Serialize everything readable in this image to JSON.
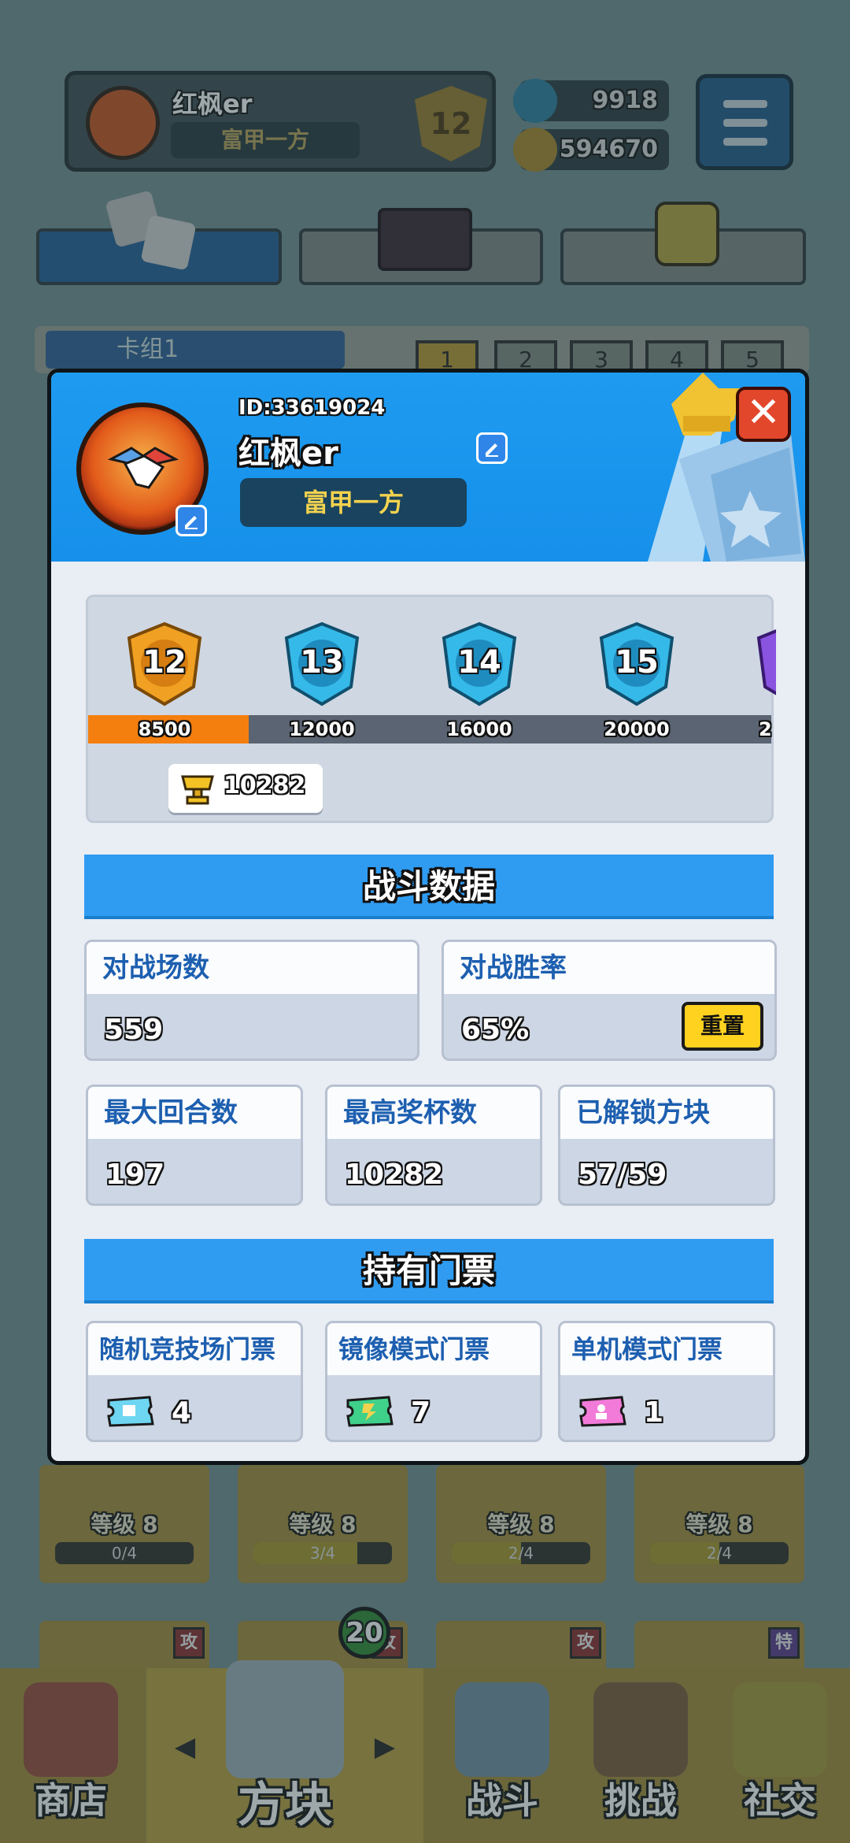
{
  "background": {
    "player": {
      "name": "红枫er",
      "title": "富甲一方",
      "rank": "12"
    },
    "currency": {
      "gems": "9918",
      "coins": "594670"
    },
    "deck_label": "卡组1",
    "deck_tabs": [
      "1",
      "2",
      "3",
      "4",
      "5"
    ],
    "cards": [
      {
        "level": "等级 8",
        "progress": "0/4",
        "fill": 0
      },
      {
        "level": "等级 8",
        "progress": "3/4",
        "fill": 0.75
      },
      {
        "level": "等级 8",
        "progress": "2/4",
        "fill": 0.5
      },
      {
        "level": "等级 8",
        "progress": "2/4",
        "fill": 0.5
      }
    ],
    "card_tags": [
      "攻",
      "攻",
      "攻",
      "特"
    ],
    "block_badge": "20"
  },
  "bottom_nav": [
    {
      "label": "商店",
      "active": false
    },
    {
      "label": "方块",
      "active": true
    },
    {
      "label": "战斗",
      "active": false
    },
    {
      "label": "挑战",
      "active": false
    },
    {
      "label": "社交",
      "active": false
    }
  ],
  "modal": {
    "id_text": "ID:33619024",
    "name": "红枫er",
    "title": "富甲一方",
    "close_label": "✕",
    "ranks": [
      {
        "level": "12",
        "threshold": "8500",
        "color": "#f0a022"
      },
      {
        "level": "13",
        "threshold": "12000",
        "color": "#35b9e8"
      },
      {
        "level": "14",
        "threshold": "16000",
        "color": "#35b9e8"
      },
      {
        "level": "15",
        "threshold": "20000",
        "color": "#35b9e8"
      },
      {
        "level": "",
        "threshold": "2",
        "color": "#8a53e0"
      }
    ],
    "rank_progress_fill": 0.235,
    "trophies": "10282",
    "battle_section": "战斗数据",
    "stats_top": [
      {
        "label": "对战场数",
        "value": "559"
      },
      {
        "label": "对战胜率",
        "value": "65%"
      }
    ],
    "reset_label": "重置",
    "stats_bottom": [
      {
        "label": "最大回合数",
        "value": "197"
      },
      {
        "label": "最高奖杯数",
        "value": "10282"
      },
      {
        "label": "已解锁方块",
        "value": "57/59"
      }
    ],
    "tickets_section": "持有门票",
    "tickets": [
      {
        "label": "随机竞技场门票",
        "count": "4",
        "color": "#6fd6f2"
      },
      {
        "label": "镜像模式门票",
        "count": "7",
        "color": "#3fd08a"
      },
      {
        "label": "单机模式门票",
        "count": "1",
        "color": "#f27ad8"
      }
    ]
  }
}
